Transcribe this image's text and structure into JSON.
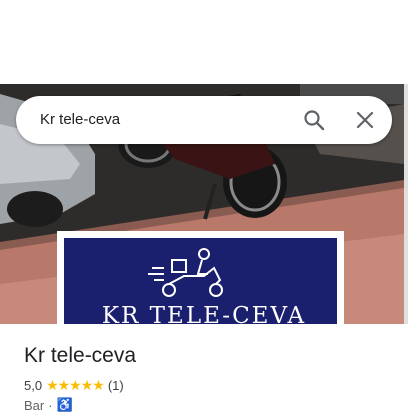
{
  "search": {
    "query": "Kr tele-ceva"
  },
  "hero": {
    "sign_text": "KR TELE-CEVA"
  },
  "place": {
    "name": "Kr tele-ceva",
    "rating": "5,0",
    "stars": "★★★★★",
    "review_count": "(1)",
    "category": "Bar",
    "separator": "·",
    "accessibility_icon": "wheelchair-icon"
  },
  "colors": {
    "accent": "#1a73e8",
    "star": "#fbbc04",
    "sign_background": "#1a1f6e"
  }
}
